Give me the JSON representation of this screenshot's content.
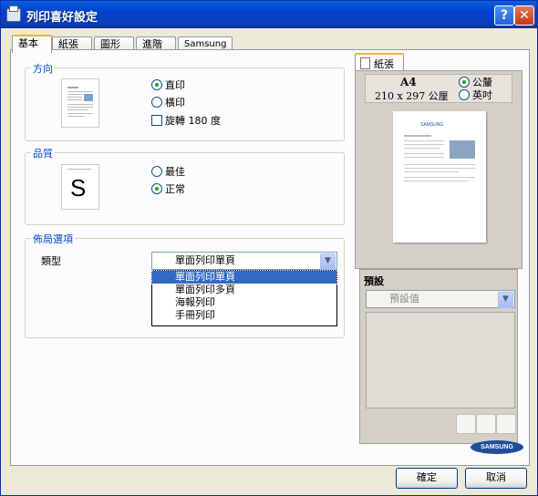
{
  "window": {
    "title": "列印喜好設定",
    "help_label": "?",
    "close_label": "✕"
  },
  "tabs": [
    {
      "label": "基本",
      "active": true
    },
    {
      "label": "紙張"
    },
    {
      "label": "圖形"
    },
    {
      "label": "進階"
    },
    {
      "label": "Samsung"
    }
  ],
  "orientation": {
    "title": "方向",
    "options": [
      "直印",
      "橫印"
    ],
    "selected": "直印",
    "rotate_label": "旋轉 180 度",
    "rotate_checked": false
  },
  "quality": {
    "title": "品質",
    "options": [
      "最佳",
      "正常"
    ],
    "selected": "正常",
    "badge": "S"
  },
  "layout": {
    "title": "佈局選項",
    "type_label": "類型",
    "type_value": "單面列印單頁",
    "dropdown_options": [
      "單面列印單頁",
      "單面列印多頁",
      "海報列印",
      "手冊列印"
    ],
    "dropdown_selected_index": 0
  },
  "preview": {
    "tab_label": "紙張",
    "paper_name": "A4",
    "paper_size": "210 x 297 公厘",
    "units": [
      "公釐",
      "英吋"
    ],
    "unit_selected": "公釐",
    "thumb_brand": "SAMSUNG"
  },
  "presets": {
    "title": "預設",
    "value": "預設值"
  },
  "brand": {
    "logo_text": "SAMSUNG"
  },
  "buttons": {
    "ok": "確定",
    "cancel": "取消"
  },
  "colors": {
    "titlebar": "#0a5fe0",
    "group_title": "#0046d5",
    "selection": "#316ac5",
    "brand_blue": "#1f4e9a"
  }
}
